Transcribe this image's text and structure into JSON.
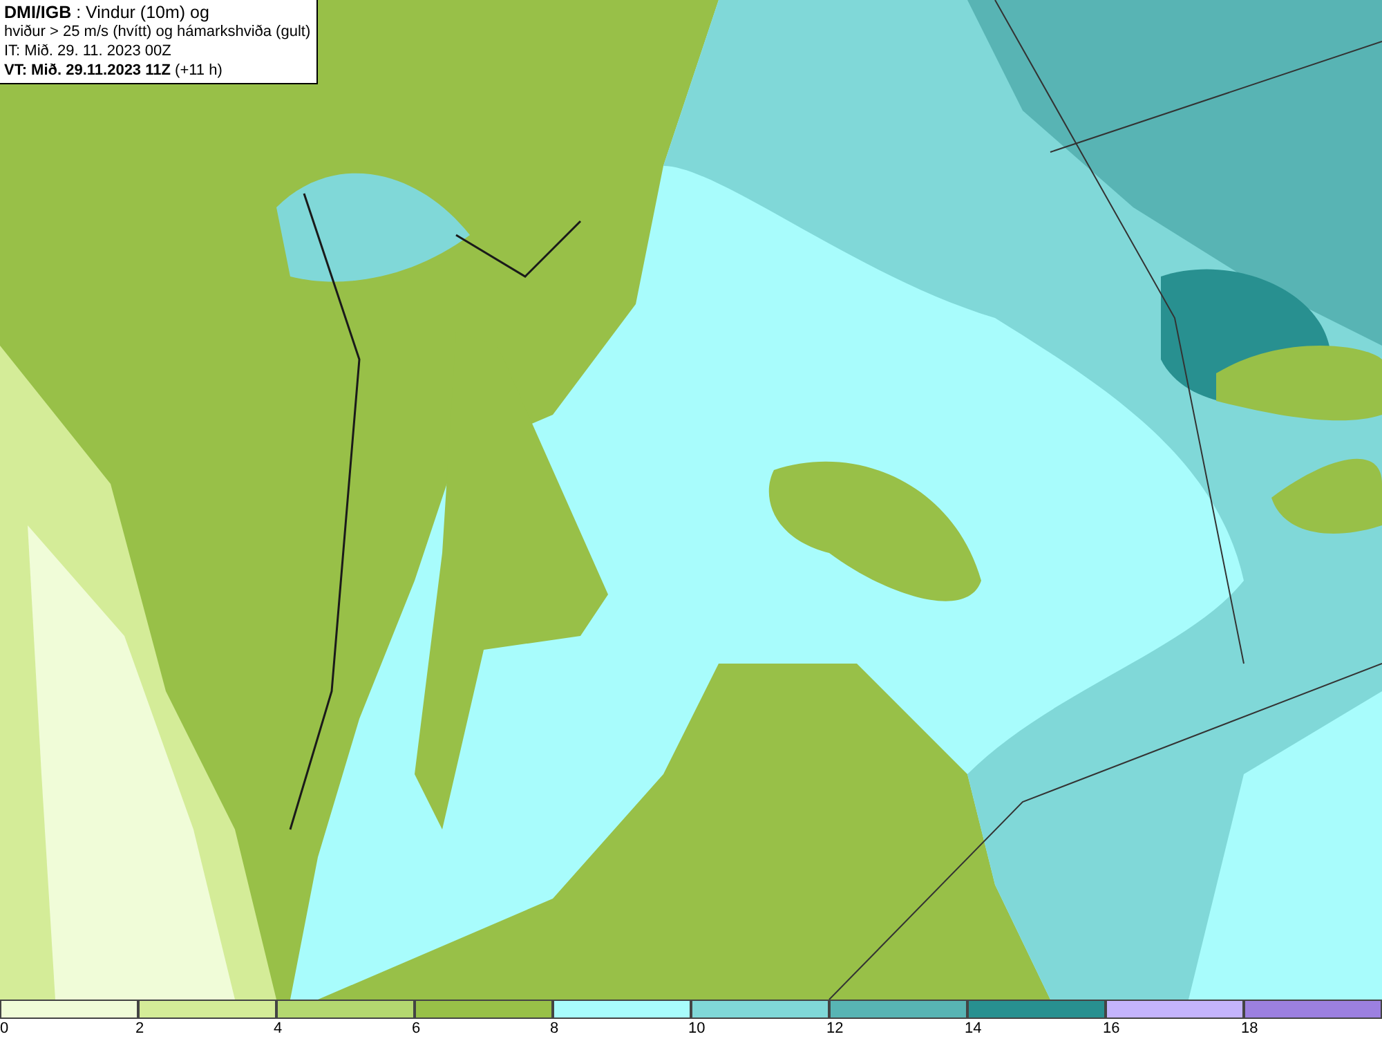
{
  "title_box": {
    "lines": [
      "**DMI/IGB** : Vindur (10m) og",
      "hviður > 25 m/s (hvítt) og hámarkshviða (gult)",
      "IT: Mið. 29. 11. 2023 00Z",
      "**VT: Mið. 29.11.2023 11Z** (+11 h)"
    ]
  },
  "legend": {
    "bins": [
      {
        "label": "0",
        "color": "#f0fcd8"
      },
      {
        "label": "2",
        "color": "#d4ec98"
      },
      {
        "label": "4",
        "color": "#b4d870"
      },
      {
        "label": "6",
        "color": "#98c048"
      },
      {
        "label": "8",
        "color": "#a8fcfc"
      },
      {
        "label": "10",
        "color": "#80d8d8"
      },
      {
        "label": "12",
        "color": "#58b4b4"
      },
      {
        "label": "14",
        "color": "#289090"
      },
      {
        "label": "16",
        "color": "#c4b4fc"
      },
      {
        "label": "18",
        "color": "#9c80e0"
      }
    ]
  }
}
